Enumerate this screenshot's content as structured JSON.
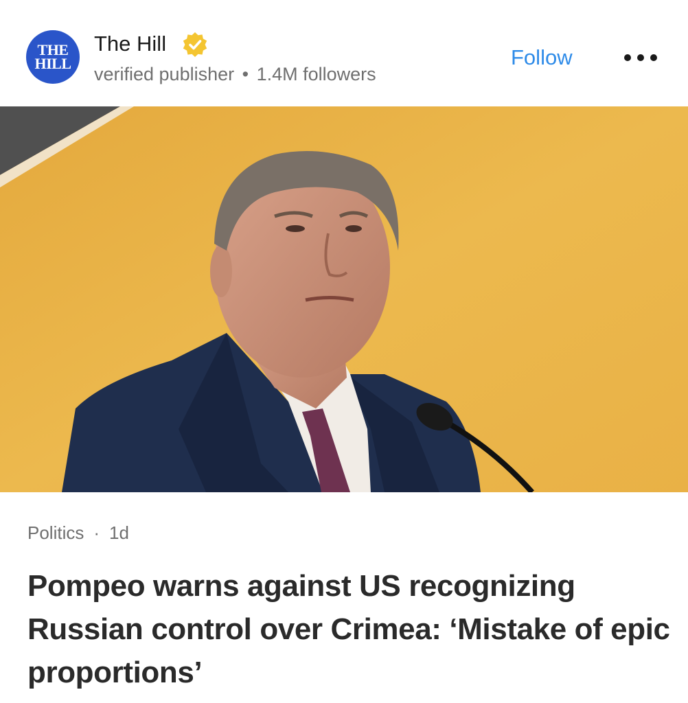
{
  "publisher": {
    "logo_text_top": "THE",
    "logo_text_bottom": "HILL",
    "name": "The Hill",
    "status": "verified publisher",
    "followers": "1.4M followers",
    "badge_icon": "verified-badge-icon",
    "badge_color": "#f4c531",
    "logo_color": "#2a55c9"
  },
  "actions": {
    "follow_label": "Follow",
    "more_icon": "more-dots-icon",
    "accent": "#2e8be8"
  },
  "hero": {
    "background_color": "#eab54a"
  },
  "article": {
    "category": "Politics",
    "separator": "·",
    "age": "1d",
    "headline": "Pompeo warns against US recognizing Russian control over Crimea: ‘Mistake of epic proportions’"
  }
}
